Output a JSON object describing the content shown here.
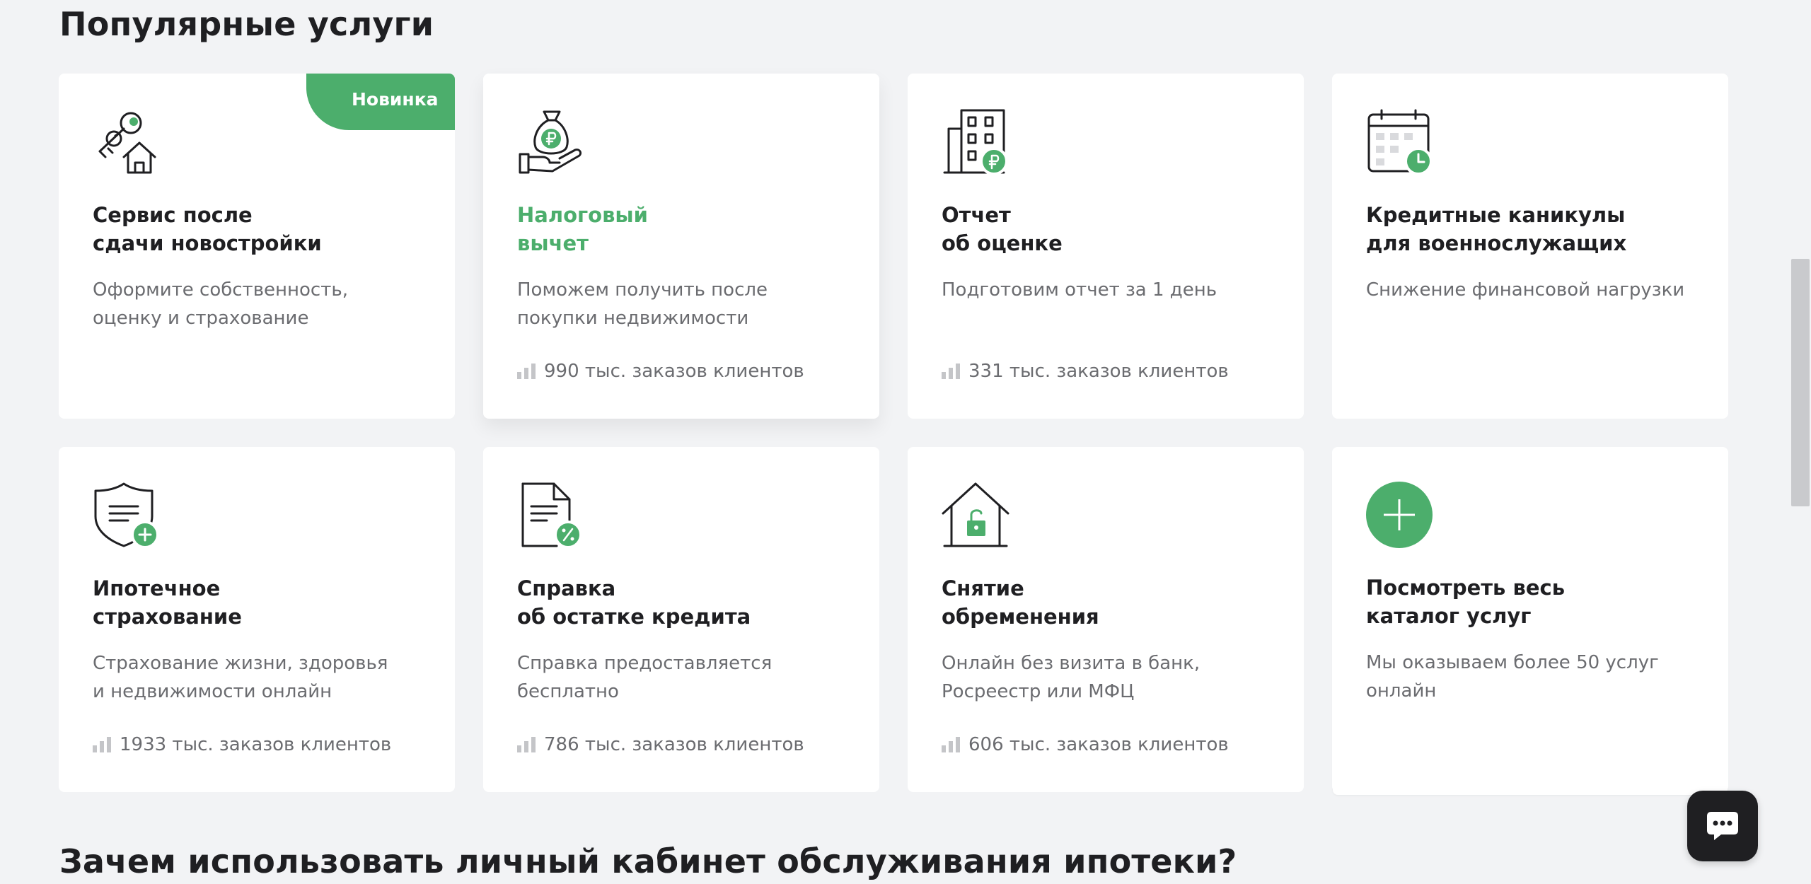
{
  "page": {
    "section_title": "Популярные услуги",
    "bottom_title": "Зачем использовать личный кабинет обслуживания ипотеки?"
  },
  "colors": {
    "accent": "#4cae6c",
    "text": "#1f1f22",
    "muted": "#6b6c70",
    "background": "#f2f3f5"
  },
  "services": [
    {
      "icon": "keys-house-icon",
      "badge": "Новинка",
      "title": "Сервис после\nсдачи новостройки",
      "description": "Оформите собственность,\nоценку и страхование"
    },
    {
      "icon": "money-bag-hand-icon",
      "title": "Налоговый\nвычет",
      "description": "Поможем получить после\nпокупки недвижимости",
      "orders": "990 тыс. заказов клиентов"
    },
    {
      "icon": "building-ruble-icon",
      "title": "Отчет\nоб оценке",
      "description": "Подготовим отчет за 1 день",
      "orders": "331 тыс. заказов клиентов"
    },
    {
      "icon": "calendar-clock-icon",
      "title": "Кредитные каникулы\nдля военнослужащих",
      "description": "Снижение финансовой нагрузки"
    },
    {
      "icon": "shield-document-plus-icon",
      "title": "Ипотечное\nстрахование",
      "description": "Страхование жизни, здоровья\nи недвижимости онлайн",
      "orders": "1933 тыс. заказов клиентов"
    },
    {
      "icon": "document-percent-icon",
      "title": "Справка\nоб остатке кредита",
      "description": "Справка предоставляется\nбесплатно",
      "orders": "786 тыс. заказов клиентов"
    },
    {
      "icon": "house-unlock-icon",
      "title": "Снятие\nобременения",
      "description": "Онлайн без визита в банк,\nРосреестр или МФЦ",
      "orders": "606 тыс. заказов клиентов"
    },
    {
      "icon": "plus-circle-icon",
      "title": "Посмотреть весь\nкаталог услуг",
      "description": "Мы оказываем более 50 услуг\nонлайн"
    }
  ],
  "chat": {
    "icon": "chat-bubble-icon"
  }
}
